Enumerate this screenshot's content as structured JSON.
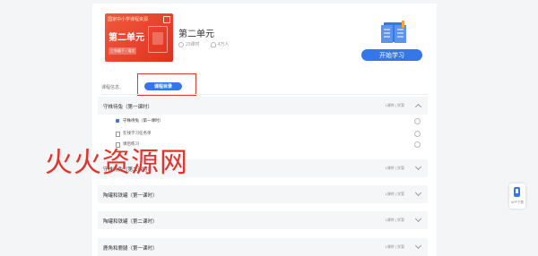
{
  "course": {
    "cover": {
      "brand": "国家中小学课程资源",
      "unit": "第二单元",
      "grade": "三年级下 / 语文"
    },
    "title": "第二单元",
    "meta": {
      "lessons": "23课时",
      "learners": "4万人"
    },
    "start_label": "开始学习"
  },
  "tabs": {
    "intro": "课程信息",
    "catalog": "课程目录"
  },
  "chapters": [
    {
      "title": "守株待兔（第一课时）",
      "meta": "1课时 | 学案",
      "expanded": true,
      "lessons": [
        {
          "label": "守株待兔（第一课时）",
          "type": "video"
        },
        {
          "label": "在线学习任务单",
          "type": "doc"
        },
        {
          "label": "课后练习",
          "type": "doc"
        }
      ]
    },
    {
      "title": "守株待兔（第二课时）",
      "meta": "1课时 | 学案",
      "expanded": false
    },
    {
      "title": "陶罐和铁罐（第一课时）",
      "meta": "1课时 | 学案",
      "expanded": false
    },
    {
      "title": "陶罐和铁罐（第二课时）",
      "meta": "1课时 | 学案",
      "expanded": false
    },
    {
      "title": "鹿角和鹿腿（第一课时）",
      "meta": "1课时 | 学案",
      "expanded": false
    }
  ],
  "watermark": "火火资源网",
  "app_float": {
    "label": "APP下载"
  },
  "colors": {
    "accent": "#3576e8",
    "cover": "#e0301e",
    "highlight": "#e23b2e"
  }
}
